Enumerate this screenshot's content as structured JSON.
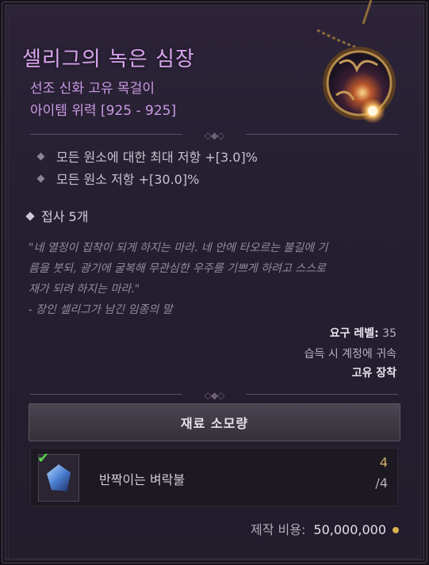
{
  "item": {
    "name": "셀리그의 녹은 심장",
    "type": "선조 신화 고유 목걸이",
    "power": "아이템 위력 [925 - 925]"
  },
  "affixes": [
    "모든 원소에 대한 최대 저항 +[3.0]%",
    "모든 원소 저항 +[30.0]%"
  ],
  "temper": "접사 5개",
  "flavor": {
    "line1": "\"네 열정이 집착이 되게 하지는 마라. 네 안에 타오르는 불길에 기",
    "line2": "름을 붓되, 광기에 굴복해 무관심한 우주를 기쁘게 하려고 스스로",
    "line3": "재가 되려 하지는 마라.\"",
    "author": "- 장인 셀리그가 남긴 임종의 말"
  },
  "requirements": {
    "level_label": "요구 레벨:",
    "level_value": "35",
    "bind": "습득 시 계정에 귀속",
    "equip": "고유 장착"
  },
  "material_header": "재료 소모량",
  "material": {
    "name": "반짝이는 벼락불",
    "have": "4",
    "need": "/4",
    "icon": "gem-icon",
    "check_icon": "check-icon"
  },
  "cost": {
    "label": "제작 비용:",
    "value": "50,000,000",
    "icon": "gold-coin-icon"
  },
  "colors": {
    "mythic_name": "#d9a5ee",
    "mythic_sub": "#c99ae2",
    "have_count": "#d8b36b",
    "check": "#58d24a"
  }
}
